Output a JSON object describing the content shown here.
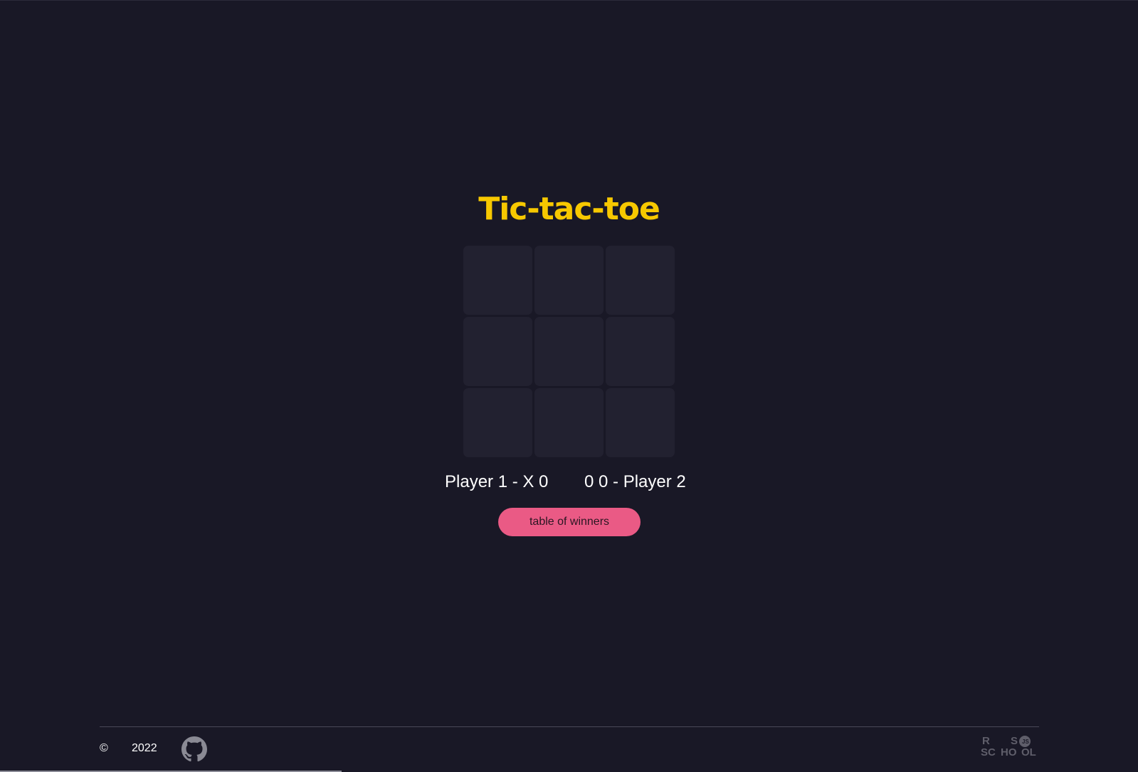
{
  "app": {
    "title": "Tic-tac-toe"
  },
  "board": {
    "cells": [
      "",
      "",
      "",
      "",
      "",
      "",
      "",
      "",
      ""
    ]
  },
  "score": {
    "left": "Player 1 - X 0",
    "right": "0 0 - Player 2"
  },
  "actions": {
    "winners_label": "table of winners"
  },
  "footer": {
    "copyright_symbol": "©",
    "year": "2022",
    "github_icon": "github-icon",
    "school_logo": "rs-school-logo"
  },
  "colors": {
    "background": "#191826",
    "title": "#f7c800",
    "cell": "#222130",
    "button": "#ea5a85",
    "text": "#ffffff"
  }
}
